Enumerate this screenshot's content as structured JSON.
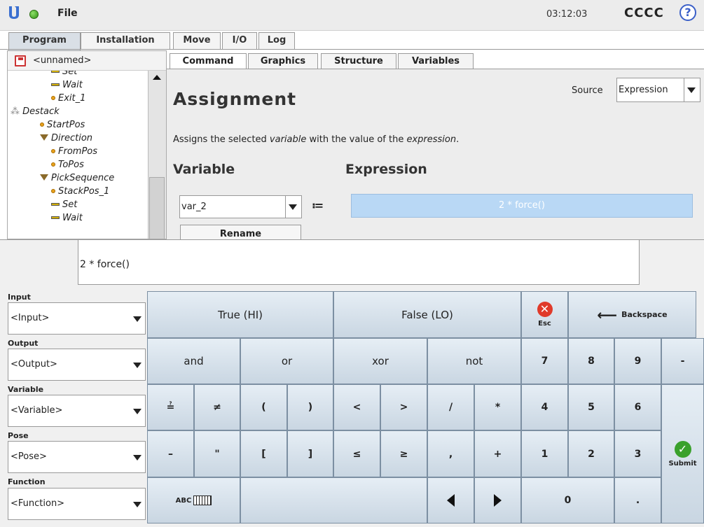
{
  "topbar": {
    "file_label": "File",
    "clock": "03:12:03",
    "user": "CCCC",
    "help": "?"
  },
  "main_tabs": [
    "Program",
    "Installation",
    "Move",
    "I/O",
    "Log"
  ],
  "program": {
    "name": "<unnamed>"
  },
  "tree": [
    {
      "label": "Set",
      "icon": "bar"
    },
    {
      "label": "Wait",
      "icon": "bar"
    },
    {
      "label": "Exit_1",
      "icon": "bullet"
    },
    {
      "label": "Destack",
      "icon": "pallet"
    },
    {
      "label": "StartPos",
      "icon": "bullet"
    },
    {
      "label": "Direction",
      "icon": "triangle"
    },
    {
      "label": "FromPos",
      "icon": "bullet"
    },
    {
      "label": "ToPos",
      "icon": "bullet"
    },
    {
      "label": "PickSequence",
      "icon": "triangle"
    },
    {
      "label": "StackPos_1",
      "icon": "bullet"
    },
    {
      "label": "Set",
      "icon": "bar"
    },
    {
      "label": "Wait",
      "icon": "bar"
    }
  ],
  "sub_tabs": [
    "Command",
    "Graphics",
    "Structure",
    "Variables"
  ],
  "assignment": {
    "title": "Assignment",
    "source_label": "Source",
    "source_value": "Expression",
    "desc_pre": "Assigns the selected ",
    "desc_var": "variable",
    "desc_mid": " with the value of the ",
    "desc_expr": "expression",
    "desc_end": ".",
    "variable_heading": "Variable",
    "expression_heading": "Expression",
    "variable_value": "var_2",
    "assign_op": "≔",
    "expression_value": "2 * force()",
    "rename_label": "Rename"
  },
  "keyboard": {
    "expression": "2 * force()",
    "categories": [
      {
        "label": "Input",
        "value": "<Input>"
      },
      {
        "label": "Output",
        "value": "<Output>"
      },
      {
        "label": "Variable",
        "value": "<Variable>"
      },
      {
        "label": "Pose",
        "value": "<Pose>"
      },
      {
        "label": "Function",
        "value": "<Function>"
      }
    ],
    "keys": {
      "true": "True (HI)",
      "false": "False (LO)",
      "esc": "Esc",
      "backspace": "Backspace",
      "and": "and",
      "or": "or",
      "xor": "xor",
      "not": "not",
      "eq": "≟",
      "neq": "≠",
      "lparen": "(",
      "rparen": ")",
      "lt": "<",
      "gt": ">",
      "div": "/",
      "mul": "*",
      "minus": "–",
      "quote": "\"",
      "lbracket": "[",
      "rbracket": "]",
      "le": "≤",
      "ge": "≥",
      "comma": ",",
      "plus": "+",
      "abc": "ABC",
      "n7": "7",
      "n8": "8",
      "n9": "9",
      "dash": "-",
      "n4": "4",
      "n5": "5",
      "n6": "6",
      "n1": "1",
      "n2": "2",
      "n3": "3",
      "n0": "0",
      "dot": ".",
      "submit": "Submit"
    }
  },
  "colors": {
    "key_top": "#e6eef5",
    "key_bottom": "#c9d6e2",
    "expression_bg": "#b9d8f5",
    "esc": "#e03a2a",
    "submit": "#3aa12c"
  }
}
